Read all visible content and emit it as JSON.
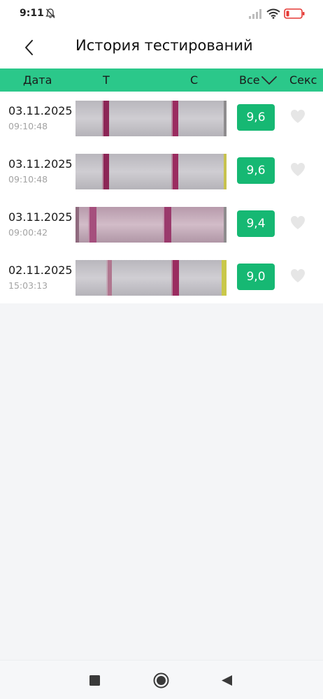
{
  "status_bar": {
    "time": "9:11",
    "icons": [
      "bell-muted-icon",
      "signal-icon",
      "wifi-icon",
      "battery-low-icon"
    ],
    "battery_color": "#e53935"
  },
  "header": {
    "title": "История тестирований",
    "back_icon": "chevron-left-icon"
  },
  "table_header": {
    "date": "Дата",
    "t": "T",
    "c": "C",
    "filter": "Все",
    "sex": "Секс",
    "filter_icon": "chevron-down-icon",
    "background_color": "#2bc88a"
  },
  "tests": [
    {
      "date": "03.11.2025",
      "time": "09:10:48",
      "value": "9,6",
      "heart_icon": "heart-icon",
      "liked": false
    },
    {
      "date": "03.11.2025",
      "time": "09:10:48",
      "value": "9,6",
      "heart_icon": "heart-icon",
      "liked": false
    },
    {
      "date": "03.11.2025",
      "time": "09:00:42",
      "value": "9,4",
      "heart_icon": "heart-icon",
      "liked": false
    },
    {
      "date": "02.11.2025",
      "time": "15:03:13",
      "value": "9,0",
      "heart_icon": "heart-icon",
      "liked": false
    }
  ],
  "colors": {
    "accent": "#2bc88a",
    "badge": "#16b873",
    "line": "#a3285e",
    "heart": "#e6e6e6"
  },
  "nav_bar": {
    "icons": [
      "square-recents-icon",
      "circle-home-icon",
      "triangle-back-icon"
    ]
  }
}
